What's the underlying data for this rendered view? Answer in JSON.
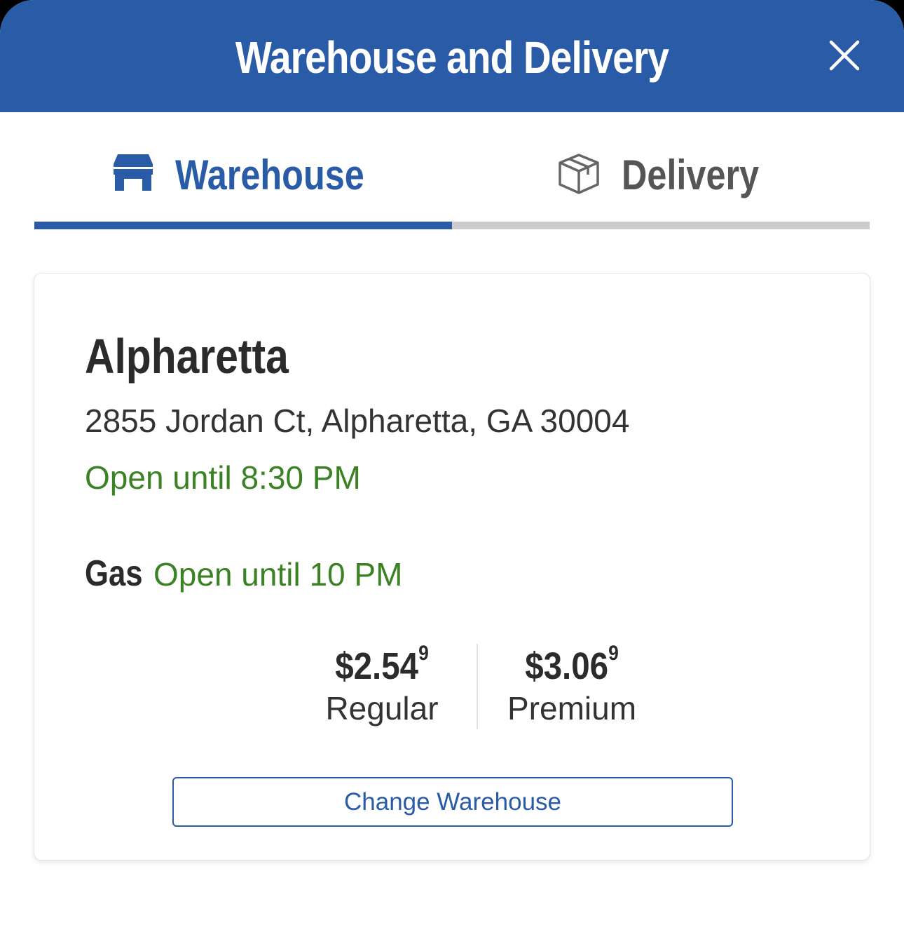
{
  "header": {
    "title": "Warehouse and Delivery",
    "close_icon": "close-icon"
  },
  "tabs": [
    {
      "label": "Warehouse",
      "icon": "store-icon",
      "active": true
    },
    {
      "label": "Delivery",
      "icon": "box-icon",
      "active": false
    }
  ],
  "warehouse": {
    "name": "Alpharetta",
    "address": "2855 Jordan Ct, Alpharetta, GA 30004",
    "hours": "Open until 8:30 PM",
    "gas": {
      "label": "Gas",
      "hours": "Open until 10 PM",
      "prices": [
        {
          "price": "$2.54",
          "fraction": "9",
          "grade": "Regular"
        },
        {
          "price": "$3.06",
          "fraction": "9",
          "grade": "Premium"
        }
      ]
    },
    "change_button": "Change Warehouse"
  },
  "colors": {
    "brand_blue": "#2a5ba6",
    "open_green": "#3b8224",
    "text_dark": "#2b2b2b",
    "inactive_gray": "#cccccc"
  }
}
